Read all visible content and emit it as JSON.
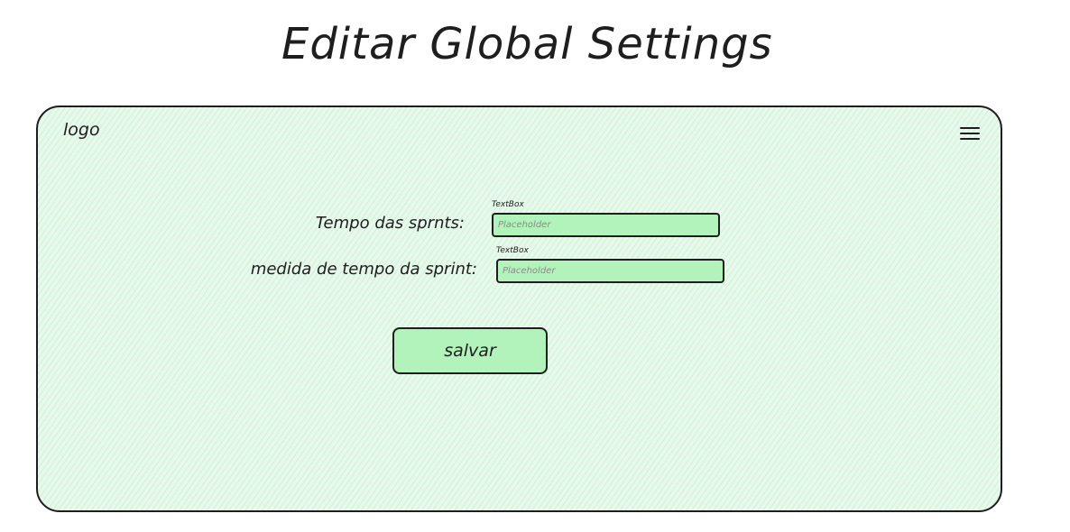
{
  "header": {
    "title": "Editar Global Settings"
  },
  "frame": {
    "logo": "logo",
    "menu_icon": "hamburger-menu-icon"
  },
  "form": {
    "fields": [
      {
        "caption": "TextBox",
        "label": "Tempo das sprnts:",
        "placeholder": "Placeholder",
        "value": ""
      },
      {
        "caption": "TextBox",
        "label": "medida de tempo da sprint:",
        "placeholder": "Placeholder",
        "value": ""
      }
    ],
    "save_label": "salvar"
  },
  "colors": {
    "accent_fill": "#b2f2bb",
    "frame_fill": "#e9f8ec",
    "stroke": "#1e1e1e"
  }
}
